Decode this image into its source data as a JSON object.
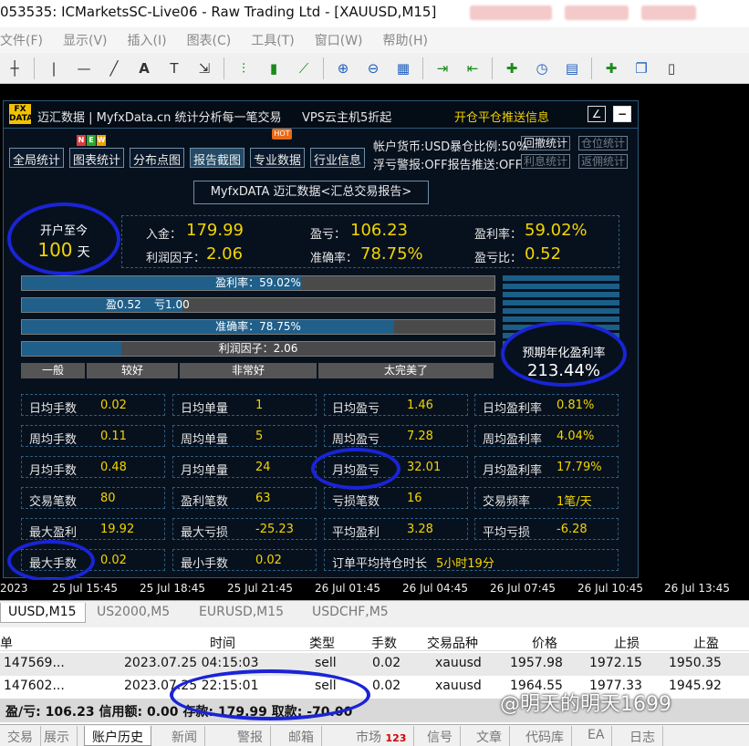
{
  "window": {
    "title": "053535: ICMarketsSC-Live06 - Raw Trading Ltd - [XAUUSD,M15]"
  },
  "menu": [
    "文件(F)",
    "显示(V)",
    "插入(I)",
    "图表(C)",
    "工具(T)",
    "窗口(W)",
    "帮助(H)"
  ],
  "panel": {
    "logo_top": "FX",
    "logo_bottom": "DATA",
    "header": "迈汇数据 | MyfxData.cn  统计分析每一笔交易",
    "vps": "VPS云主机5折起",
    "push": "开仓平仓推送信息",
    "nav": [
      "全局统计",
      "图表统计",
      "分布点图",
      "报告截图",
      "专业数据",
      "行业信息"
    ],
    "hot_badge": "HOT",
    "account_currency": "帐户货币:USD暴仓比例:50%",
    "float_alert": "浮亏警报:OFF报告推送:OFF",
    "buttons": [
      "回撤统计",
      "仓位统计",
      "利息统计",
      "返佣统计"
    ],
    "report_title": "MyfxDATA 迈汇数据<汇总交易报告>"
  },
  "summary": {
    "since_label": "开户至今",
    "days_value": "100",
    "days_unit": "天",
    "deposit_label": "入金：",
    "deposit_value": "179.99",
    "profit_label": "盈亏：",
    "profit_value": "106.23",
    "profit_rate_label": "盈利率：",
    "profit_rate_value": "59.02%",
    "profit_factor_label": "利润因子：",
    "profit_factor_value": "2.06",
    "accuracy_label": "准确率：",
    "accuracy_value": "78.75%",
    "pl_ratio_label": "盈亏比：",
    "pl_ratio_value": "0.52"
  },
  "bars": {
    "profit_rate": {
      "text": "盈利率：59.02%",
      "fraction": 0.59
    },
    "win": "盈0.52",
    "loss": "亏1.00",
    "win_fraction": 0.34,
    "accuracy": {
      "text": "准确率：78.75%",
      "fraction": 0.7875
    },
    "profit_factor": {
      "text": "利润因子：2.06",
      "fraction": 0.21
    },
    "scale": [
      "一般",
      "较好",
      "非常好",
      "太完美了"
    ]
  },
  "annual": {
    "label": "预期年化盈利率",
    "value": "213.44%"
  },
  "stats": [
    [
      [
        "日均手数",
        "0.02"
      ],
      [
        "日均单量",
        "1"
      ],
      [
        "日均盈亏",
        "1.46"
      ],
      [
        "日均盈利率",
        "0.81%"
      ]
    ],
    [
      [
        "周均手数",
        "0.11"
      ],
      [
        "周均单量",
        "5"
      ],
      [
        "周均盈亏",
        "7.28"
      ],
      [
        "周均盈利率",
        "4.04%"
      ]
    ],
    [
      [
        "月均手数",
        "0.48"
      ],
      [
        "月均单量",
        "24"
      ],
      [
        "月均盈亏",
        "32.01"
      ],
      [
        "月均盈利率",
        "17.79%"
      ]
    ],
    [
      [
        "交易笔数",
        "80"
      ],
      [
        "盈利笔数",
        "63"
      ],
      [
        "亏损笔数",
        "16"
      ],
      [
        "交易频率",
        "1笔/天"
      ]
    ],
    [
      [
        "最大盈利",
        "19.92"
      ],
      [
        "最大亏损",
        "-25.23"
      ],
      [
        "平均盈利",
        "3.28"
      ],
      [
        "平均亏损",
        "-6.28"
      ]
    ],
    [
      [
        "最大手数",
        "0.02"
      ],
      [
        "最小手数",
        "0.02"
      ],
      [
        "订单平均持仓时长",
        "5小时19分"
      ]
    ]
  ],
  "time_axis": [
    "2023",
    "25 Jul 15:45",
    "25 Jul 18:45",
    "25 Jul 21:45",
    "26 Jul 01:45",
    "26 Jul 04:45",
    "26 Jul 07:45",
    "26 Jul 10:45",
    "26 Jul 13:45"
  ],
  "symbol_tabs": [
    "UUSD,M15",
    "US2000,M5",
    "EURUSD,M15",
    "USDCHF,M5"
  ],
  "terminal": {
    "headers": [
      "单",
      "时间",
      "类型",
      "手数",
      "交易品种",
      "价格",
      "止损",
      "止盈"
    ],
    "rows": [
      [
        "147569...",
        "2023.07.25 04:15:03",
        "sell",
        "0.02",
        "xauusd",
        "1957.98",
        "1972.15",
        "1950.35"
      ],
      [
        "147602...",
        "2023.07.25 22:15:01",
        "sell",
        "0.02",
        "xauusd",
        "1964.55",
        "1977.33",
        "1945.92"
      ]
    ],
    "footer": "盈/亏: 106.23  信用额: 0.00  存款: 179.99  取款: -70.00"
  },
  "watermark": "@明天的明天1699",
  "bottom_tabs": [
    "交易",
    "展示",
    "账户历史",
    "新闻",
    "警报",
    "邮箱",
    "市场",
    "信号",
    "文章",
    "代码库",
    "EA",
    "日志"
  ],
  "market_badge": "123",
  "colors": {
    "panel_bg": "#07111e",
    "value_yellow": "#f3d400",
    "bar_fill": "#1f5f8a",
    "annotation_oval": "#1a24d6"
  }
}
